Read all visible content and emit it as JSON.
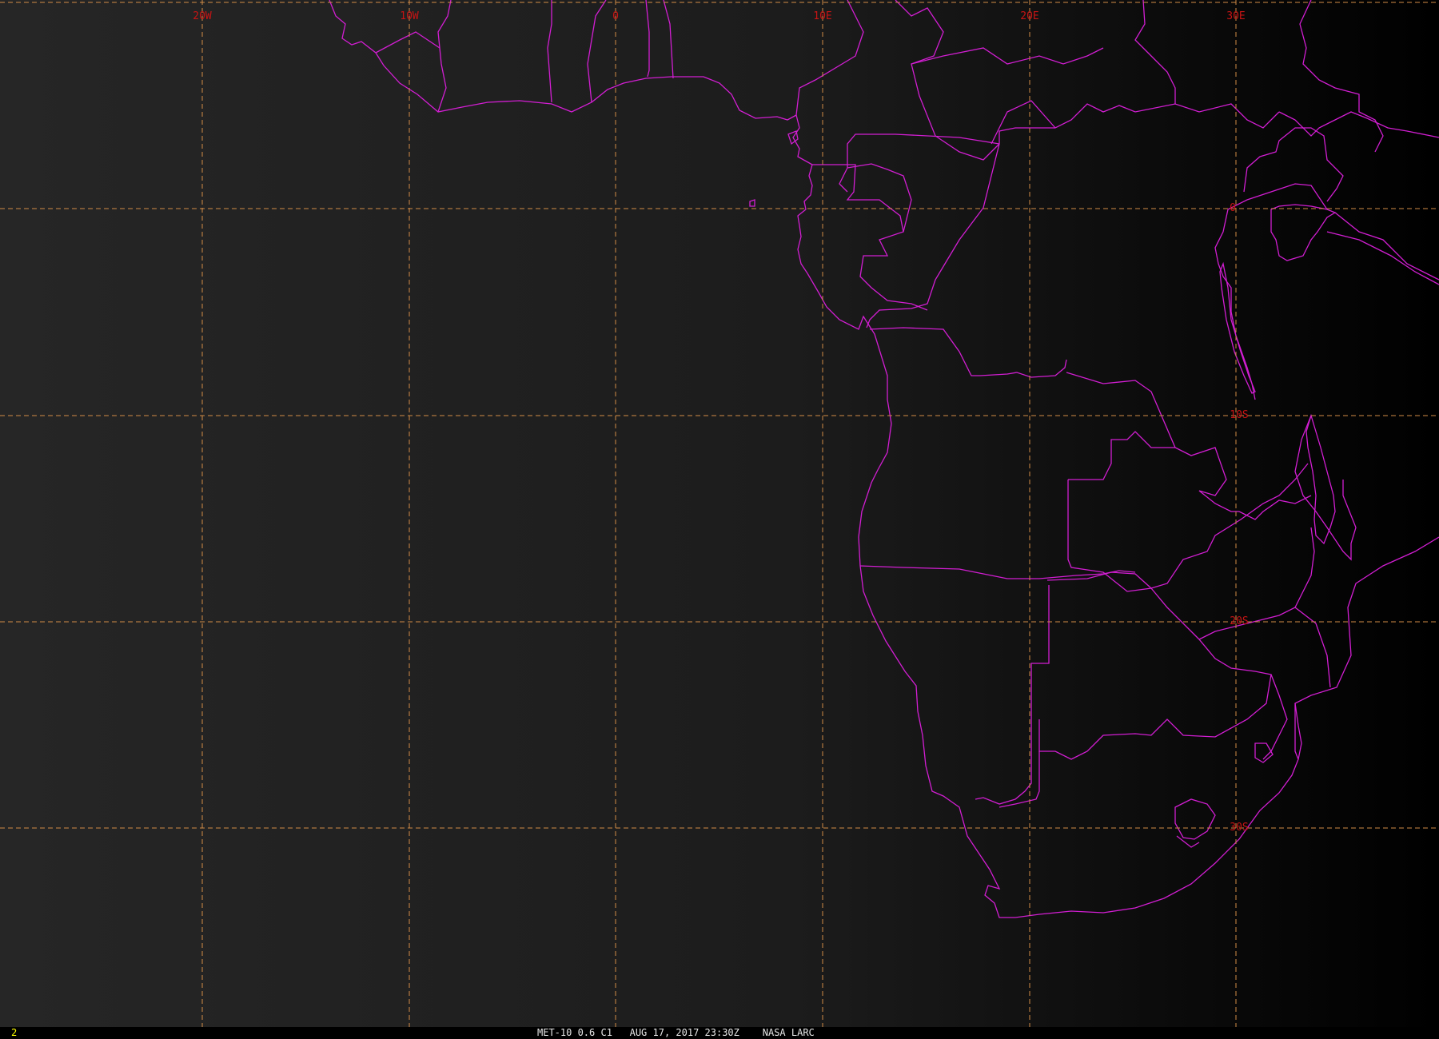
{
  "colors": {
    "coastline": "#d21ed2",
    "gridline": "#d28c46",
    "grid_label": "#c81414",
    "background_left": "#262626",
    "background_right": "#000000",
    "frame_number": "#ffff00",
    "caption": "#e6e6e6"
  },
  "grid": {
    "longitude_labels": [
      "20W",
      "10W",
      "0",
      "10E",
      "20E",
      "30E"
    ],
    "latitude_labels": [
      "0",
      "10S",
      "20S",
      "30S"
    ]
  },
  "footer": {
    "frame_number": "2",
    "caption": "MET-10 0.6 C1   AUG 17, 2017 23:30Z    NASA LARC"
  }
}
